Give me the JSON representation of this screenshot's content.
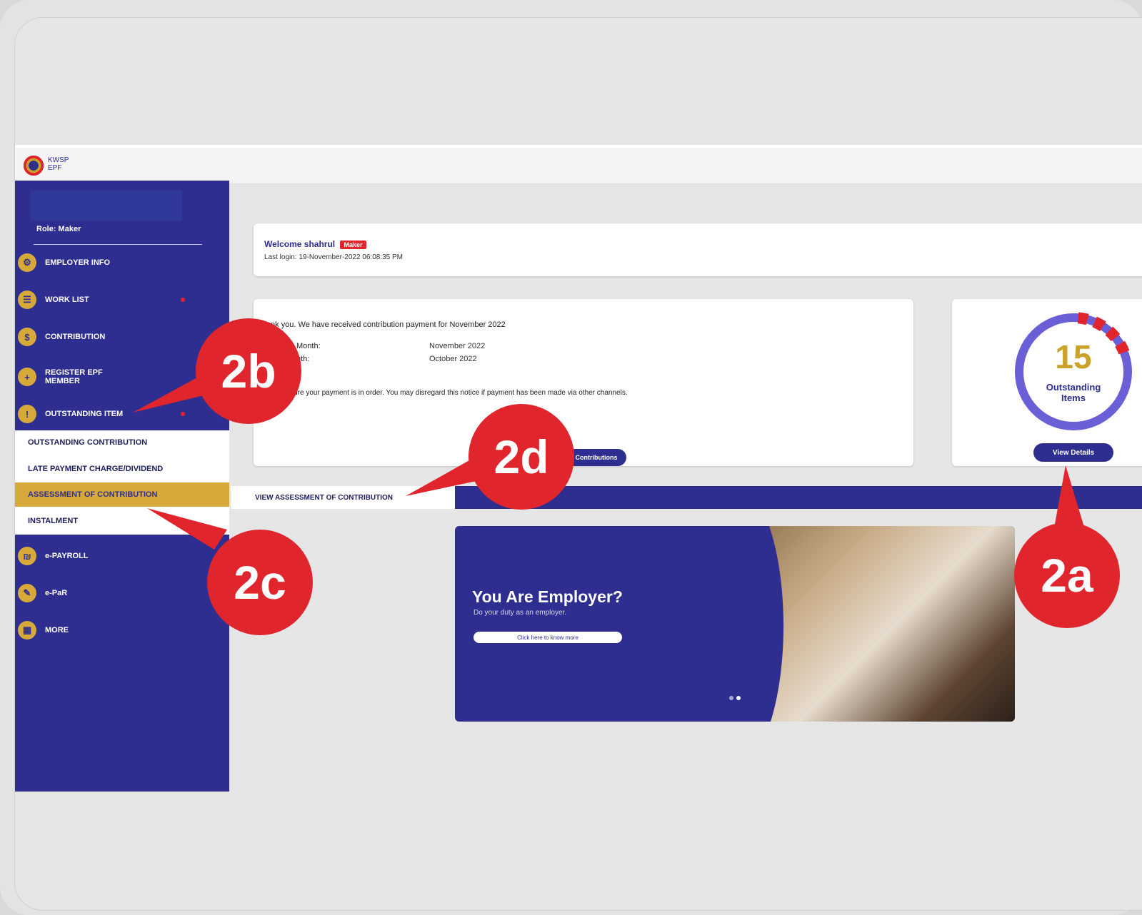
{
  "logo": {
    "line1": "KWSP",
    "line2": "EPF"
  },
  "sidebar": {
    "role": "Role: Maker",
    "items": [
      {
        "label": "EMPLOYER INFO",
        "icon": "gear-icon"
      },
      {
        "label": "WORK LIST",
        "icon": "worklist-icon"
      },
      {
        "label": "CONTRIBUTION",
        "icon": "coin-icon"
      },
      {
        "label": "REGISTER EPF MEMBER",
        "icon": "user-add-icon"
      },
      {
        "label": "OUTSTANDING ITEM",
        "icon": "alert-icon"
      },
      {
        "label": "e-PAYROLL",
        "icon": "payroll-icon"
      },
      {
        "label": "e-PaR",
        "icon": "report-icon"
      },
      {
        "label": "MORE",
        "icon": "grid-icon"
      }
    ],
    "submenu": [
      "OUTSTANDING CONTRIBUTION",
      "LATE PAYMENT CHARGE/DIVIDEND",
      "ASSESSMENT OF CONTRIBUTION",
      "INSTALMENT"
    ]
  },
  "welcome": {
    "greeting": "Welcome  shahrul",
    "badge": "Maker",
    "last_login": "Last login: 19-November-2022 06:08:35 PM"
  },
  "notice": {
    "message": "nk you. We have received contribution payment for November 2022",
    "row1_label": "Month:",
    "row1_value": "November 2022",
    "row2_label": "nth:",
    "row2_value": "October 2022",
    "note": "ensure your payment is in order. You may disregard this notice if payment has been made via other channels.",
    "button": "Contributions"
  },
  "outstanding": {
    "count": "15",
    "label_line1": "Outstanding",
    "label_line2": "Items",
    "button": "View Details"
  },
  "tab": {
    "active": "VIEW ASSESSMENT OF CONTRIBUTION"
  },
  "banner": {
    "title": "You Are Employer?",
    "subtitle": "Do your duty as an employer.",
    "button": "Click here to know more"
  },
  "callouts": {
    "a": "2a",
    "b": "2b",
    "c": "2c",
    "d": "2d"
  },
  "colors": {
    "brand": "#2d2e8f",
    "accent": "#d7a93a",
    "callout": "#e0252c"
  }
}
